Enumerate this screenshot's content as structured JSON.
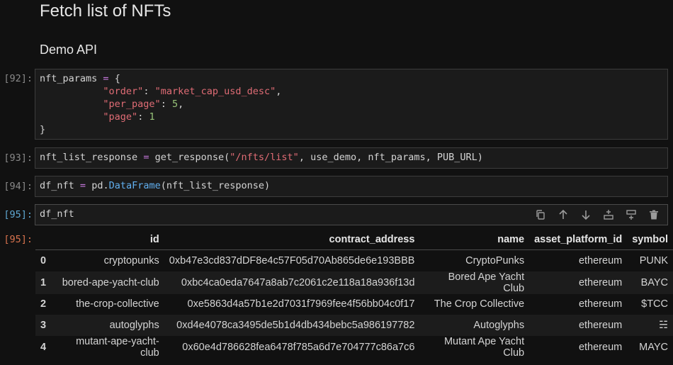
{
  "markdown": {
    "heading": "Fetch list of NFTs",
    "subheading": "Demo API"
  },
  "cells": [
    {
      "prompt": "[92]:"
    },
    {
      "prompt": "[93]:"
    },
    {
      "prompt": "[94]:"
    },
    {
      "prompt": "[95]:",
      "code": "df_nft"
    }
  ],
  "code92": {
    "var": "nft_params",
    "eq": "=",
    "open": "{",
    "k1": "\"order\"",
    "v1": "\"market_cap_usd_desc\"",
    "k2": "\"per_page\"",
    "v2": "5",
    "k3": "\"page\"",
    "v3": "1",
    "close": "}"
  },
  "code93": {
    "var": "nft_list_response",
    "eq": "=",
    "fn": "get_response(",
    "arg1": "\"/nfts/list\"",
    "rest": ", use_demo, nft_params, PUB_URL)"
  },
  "code94": {
    "var": "df_nft",
    "eq": "=",
    "mod": "pd.",
    "cls": "DataFrame",
    "rest": "(nft_list_response)"
  },
  "output": {
    "prompt": "[95]:",
    "columns": [
      "",
      "id",
      "contract_address",
      "name",
      "asset_platform_id",
      "symbol"
    ],
    "rows": [
      [
        "0",
        "cryptopunks",
        "0xb47e3cd837dDF8e4c57F05d70Ab865de6e193BBB",
        "CryptoPunks",
        "ethereum",
        "PUNK"
      ],
      [
        "1",
        "bored-ape-yacht-club",
        "0xbc4ca0eda7647a8ab7c2061c2e118a18a936f13d",
        "Bored Ape Yacht Club",
        "ethereum",
        "BAYC"
      ],
      [
        "2",
        "the-crop-collective",
        "0xe5863d4a57b1e2d7031f7969fee4f56bb04c0f17",
        "The Crop Collective",
        "ethereum",
        "$TCC"
      ],
      [
        "3",
        "autoglyphs",
        "0xd4e4078ca3495de5b1d4db434bebc5a986197782",
        "Autoglyphs",
        "ethereum",
        "☵"
      ],
      [
        "4",
        "mutant-ape-yacht-club",
        "0x60e4d786628fea6478f785a6d7e704777c86a7c6",
        "Mutant Ape Yacht Club",
        "ethereum",
        "MAYC"
      ]
    ]
  },
  "toolbar_icons": [
    "copy-icon",
    "arrow-up-icon",
    "arrow-down-icon",
    "insert-below-icon",
    "insert-above-icon",
    "trash-icon"
  ]
}
